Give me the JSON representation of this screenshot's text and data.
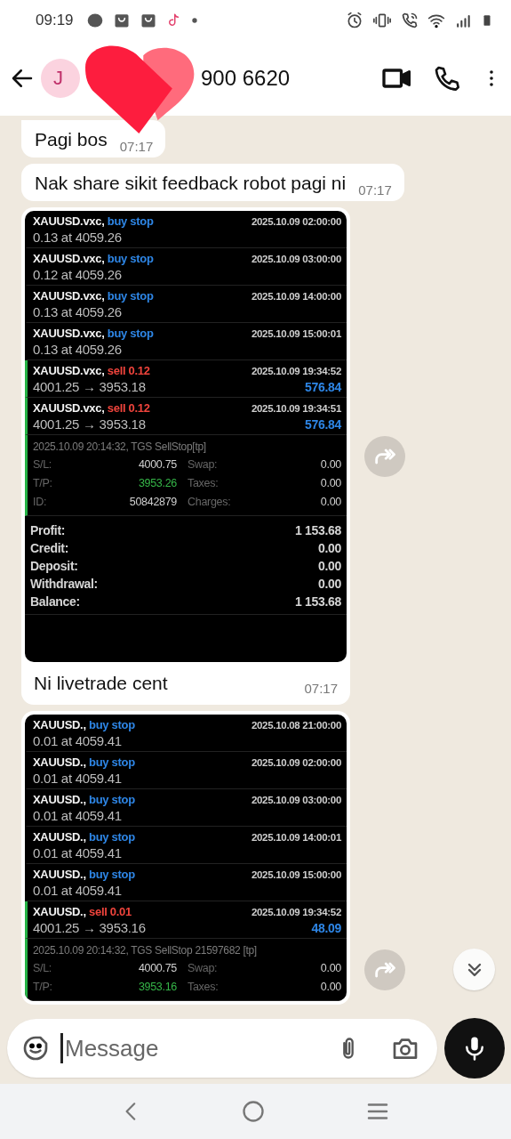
{
  "status_bar": {
    "time": "09:19"
  },
  "header": {
    "avatar_initial": "J",
    "title": "900 6620"
  },
  "messages": [
    {
      "kind": "text",
      "text": "Pagi bos",
      "time": "07:17",
      "tail": true
    },
    {
      "kind": "text",
      "text": "Nak share sikit feedback robot pagi ni",
      "time": "07:17",
      "tail": false
    },
    {
      "kind": "image",
      "time": "07:17",
      "caption": "Ni livetrade cent",
      "screen": {
        "trades": [
          {
            "symbol": "XAUUSD.vxc,",
            "action": "buy stop",
            "kind": "buy",
            "time": "2025.10.09 02:00:00",
            "line": "0.13 at 4059.26",
            "marked": false
          },
          {
            "symbol": "XAUUSD.vxc,",
            "action": "buy stop",
            "kind": "buy",
            "time": "2025.10.09 03:00:00",
            "line": "0.12 at 4059.26",
            "marked": false
          },
          {
            "symbol": "XAUUSD.vxc,",
            "action": "buy stop",
            "kind": "buy",
            "time": "2025.10.09 14:00:00",
            "line": "0.13 at 4059.26",
            "marked": false
          },
          {
            "symbol": "XAUUSD.vxc,",
            "action": "buy stop",
            "kind": "buy",
            "time": "2025.10.09 15:00:01",
            "line": "0.13 at 4059.26",
            "marked": false
          },
          {
            "symbol": "XAUUSD.vxc,",
            "action": "sell 0.12",
            "kind": "sell",
            "time": "2025.10.09 19:34:52",
            "line": "4001.25 → 3953.18",
            "profit": "576.84",
            "marked": true
          },
          {
            "symbol": "XAUUSD.vxc,",
            "action": "sell 0.12",
            "kind": "sell",
            "time": "2025.10.09 19:34:51",
            "line": "4001.25 → 3953.18",
            "profit": "576.84",
            "marked": true
          }
        ],
        "detail": {
          "comment": "2025.10.09 20:14:32, TGS SellStop[tp]",
          "rows": [
            {
              "label": "S/L:",
              "value": "4000.75",
              "target": false,
              "label_2": "Swap:",
              "value_2": "0.00"
            },
            {
              "label": "T/P:",
              "value": "3953.26",
              "target": true,
              "label_2": "Taxes:",
              "value_2": "0.00"
            },
            {
              "label": "ID:",
              "value": "50842879",
              "target": false,
              "label_2": "Charges:",
              "value_2": "0.00"
            }
          ]
        },
        "summary": [
          {
            "label": "Profit:",
            "value": "1 153.68"
          },
          {
            "label": "Credit:",
            "value": "0.00"
          },
          {
            "label": "Deposit:",
            "value": "0.00"
          },
          {
            "label": "Withdrawal:",
            "value": "0.00"
          },
          {
            "label": "Balance:",
            "value": "1 153.68"
          }
        ]
      }
    },
    {
      "kind": "image",
      "screen": {
        "trades": [
          {
            "symbol": "XAUUSD.,",
            "action": "buy stop",
            "kind": "buy",
            "time": "2025.10.08 21:00:00",
            "line": "0.01 at 4059.41",
            "marked": false
          },
          {
            "symbol": "XAUUSD.,",
            "action": "buy stop",
            "kind": "buy",
            "time": "2025.10.09 02:00:00",
            "line": "0.01 at 4059.41",
            "marked": false
          },
          {
            "symbol": "XAUUSD.,",
            "action": "buy stop",
            "kind": "buy",
            "time": "2025.10.09 03:00:00",
            "line": "0.01 at 4059.41",
            "marked": false
          },
          {
            "symbol": "XAUUSD.,",
            "action": "buy stop",
            "kind": "buy",
            "time": "2025.10.09 14:00:01",
            "line": "0.01 at 4059.41",
            "marked": false
          },
          {
            "symbol": "XAUUSD.,",
            "action": "buy stop",
            "kind": "buy",
            "time": "2025.10.09 15:00:00",
            "line": "0.01 at 4059.41",
            "marked": false
          },
          {
            "symbol": "XAUUSD.,",
            "action": "sell 0.01",
            "kind": "sell",
            "time": "2025.10.09 19:34:52",
            "line": "4001.25 → 3953.16",
            "profit": "48.09",
            "marked": true
          }
        ],
        "detail": {
          "comment": "2025.10.09 20:14:32, TGS SellStop 21597682 [tp]",
          "rows": [
            {
              "label": "S/L:",
              "value": "4000.75",
              "target": false,
              "label_2": "Swap:",
              "value_2": "0.00"
            },
            {
              "label": "T/P:",
              "value": "3953.16",
              "target": true,
              "label_2": "Taxes:",
              "value_2": "0.00"
            }
          ]
        }
      }
    }
  ],
  "composer": {
    "placeholder": "Message"
  }
}
